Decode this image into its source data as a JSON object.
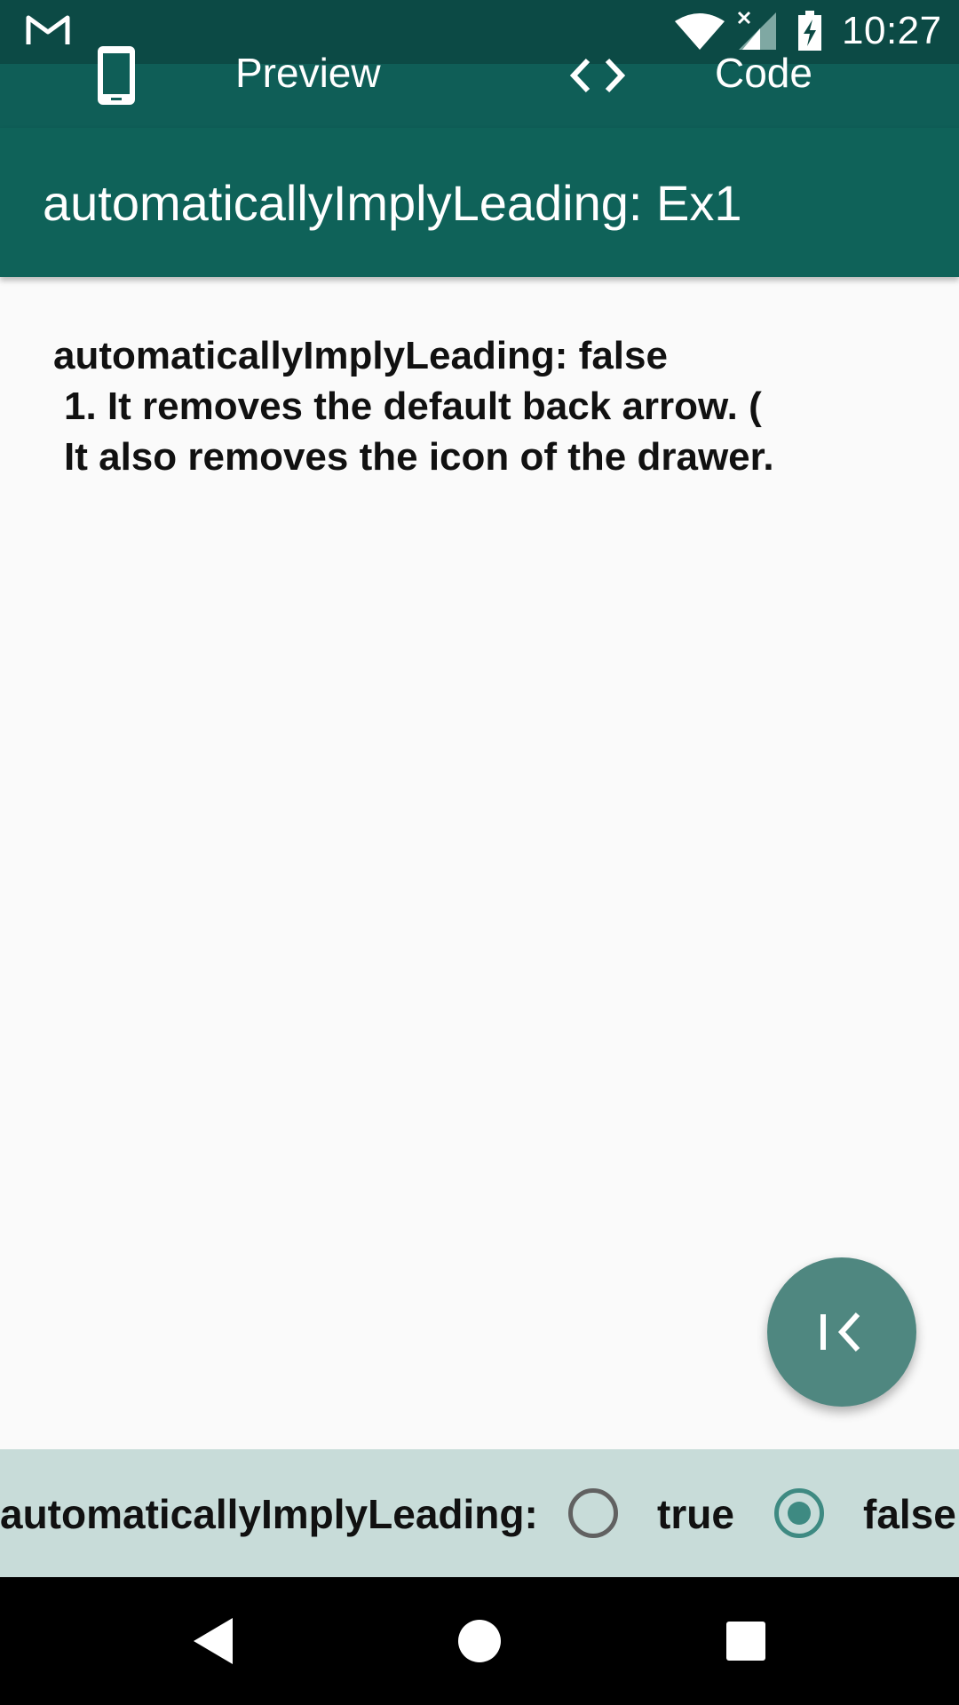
{
  "status_bar": {
    "time": "10:27",
    "icons": [
      "gmail-icon",
      "wifi-icon",
      "signal-icon",
      "battery-charging-icon"
    ]
  },
  "tabs": [
    {
      "label": "Preview",
      "icon": "phone-icon"
    },
    {
      "label": "Code",
      "icon": "code-icon"
    }
  ],
  "appbar": {
    "title": "automaticallyImplyLeading: Ex1"
  },
  "content": {
    "line1": "automaticallyImplyLeading: false",
    "line2": "1. It removes the default back arrow. (",
    "line3": "It also removes the icon of the drawer."
  },
  "fab": {
    "icon": "collapse-left-icon"
  },
  "bottom_panel": {
    "label": "automaticallyImplyLeading:",
    "options": [
      {
        "label": "true",
        "selected": false
      },
      {
        "label": "false",
        "selected": true
      }
    ]
  },
  "navbar": {
    "buttons": [
      "back-icon",
      "home-icon",
      "recents-icon"
    ]
  },
  "colors": {
    "status_bar": "#0c4a45",
    "tab_bar": "#0f5e57",
    "app_bar": "#0f6259",
    "fab": "#4f8780",
    "bottom_panel": "#c8dcd9",
    "radio_selected": "#3e8a82"
  }
}
